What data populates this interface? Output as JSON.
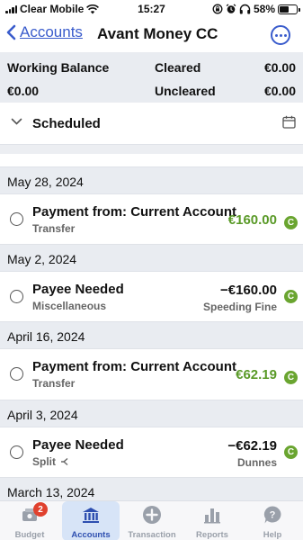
{
  "status_bar": {
    "carrier": "Clear Mobile",
    "time": "15:27",
    "battery": "58%"
  },
  "nav": {
    "back_label": "Accounts",
    "title": "Avant Money CC"
  },
  "balances": {
    "working_label": "Working Balance",
    "working_value": "€0.00",
    "cleared_label": "Cleared",
    "cleared_value": "€0.00",
    "uncleared_label": "Uncleared",
    "uncleared_value": "€0.00"
  },
  "scheduled": {
    "label": "Scheduled"
  },
  "groups": [
    {
      "date": "May 28, 2024",
      "transactions": [
        {
          "payee": "Payment from: Current Account",
          "category": "Transfer",
          "amount": "€160.00",
          "memo": "",
          "cleared": "C"
        }
      ]
    },
    {
      "date": "May 2, 2024",
      "transactions": [
        {
          "payee": "Payee Needed",
          "category": "Miscellaneous",
          "amount": "−€160.00",
          "memo": "Speeding Fine",
          "cleared": "C"
        }
      ]
    },
    {
      "date": "April 16, 2024",
      "transactions": [
        {
          "payee": "Payment from: Current Account",
          "category": "Transfer",
          "amount": "€62.19",
          "memo": "",
          "cleared": "C"
        }
      ]
    },
    {
      "date": "April 3, 2024",
      "transactions": [
        {
          "payee": "Payee Needed",
          "category": "Split",
          "amount": "−€62.19",
          "memo": "Dunnes",
          "cleared": "C"
        }
      ]
    },
    {
      "date": "March 13, 2024",
      "transactions": []
    }
  ],
  "tabs": [
    {
      "label": "Budget",
      "icon": "bank-notes-icon",
      "badge": "2"
    },
    {
      "label": "Accounts",
      "icon": "bank-icon"
    },
    {
      "label": "Transaction",
      "icon": "plus-circle-icon"
    },
    {
      "label": "Reports",
      "icon": "bar-chart-icon"
    },
    {
      "label": "Help",
      "icon": "help-icon"
    }
  ],
  "colors": {
    "accent": "#3a5ccc",
    "positive": "#5a9a28",
    "cleared_badge": "#6aa530",
    "header_bg": "#e9ecf1",
    "tab_active_bg": "#d7e4f7",
    "tab_badge": "#e0412e"
  }
}
